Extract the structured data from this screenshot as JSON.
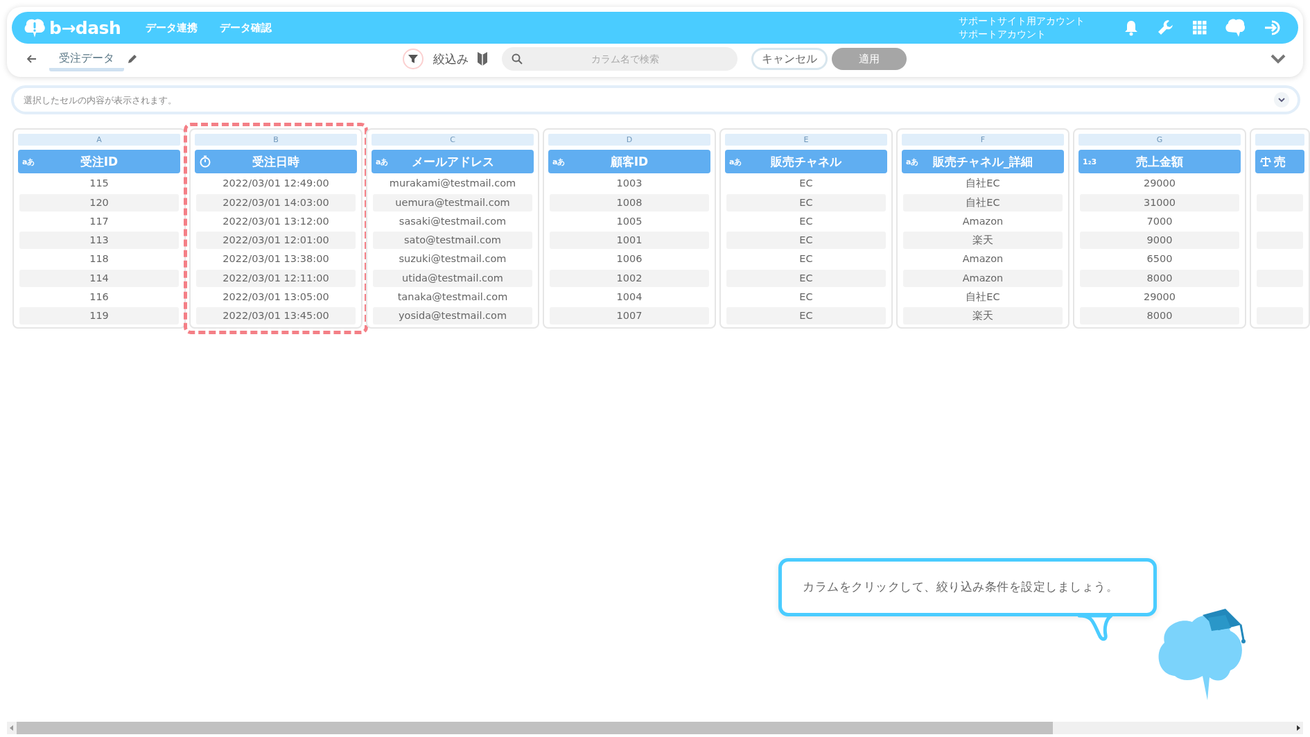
{
  "header": {
    "logo": "b→dash",
    "nav": [
      "データ連携",
      "データ確認"
    ],
    "account": [
      "サポートサイト用アカウント",
      "サポートアカウント"
    ]
  },
  "toolbar": {
    "title": "受注データ",
    "filter_label": "絞込み",
    "search": {
      "placeholder": "カラム名で検索"
    },
    "cancel": "キャンセル",
    "apply": {
      "label": "適用",
      "disabled": true
    }
  },
  "cell_bar": {
    "placeholder": "選択したセルの内容が表示されます。"
  },
  "columns": [
    {
      "letter": "A",
      "title": "受注ID",
      "kind": "text",
      "type_label": "aあ",
      "selected": false,
      "cells": [
        "115",
        "120",
        "117",
        "113",
        "118",
        "114",
        "116",
        "119"
      ]
    },
    {
      "letter": "B",
      "title": "受注日時",
      "kind": "datetime",
      "selected": true,
      "cells": [
        "2022/03/01 12:49:00",
        "2022/03/01 14:03:00",
        "2022/03/01 13:12:00",
        "2022/03/01 12:01:00",
        "2022/03/01 13:38:00",
        "2022/03/01 12:11:00",
        "2022/03/01 13:05:00",
        "2022/03/01 13:45:00"
      ]
    },
    {
      "letter": "C",
      "title": "メールアドレス",
      "kind": "text",
      "type_label": "aあ",
      "selected": false,
      "cells": [
        "murakami@testmail.com",
        "uemura@testmail.com",
        "sasaki@testmail.com",
        "sato@testmail.com",
        "suzuki@testmail.com",
        "utida@testmail.com",
        "tanaka@testmail.com",
        "yosida@testmail.com"
      ]
    },
    {
      "letter": "D",
      "title": "顧客ID",
      "kind": "text",
      "type_label": "aあ",
      "selected": false,
      "cells": [
        "1003",
        "1008",
        "1005",
        "1001",
        "1006",
        "1002",
        "1004",
        "1007"
      ]
    },
    {
      "letter": "E",
      "title": "販売チャネル",
      "kind": "text",
      "type_label": "aあ",
      "selected": false,
      "cells": [
        "EC",
        "EC",
        "EC",
        "EC",
        "EC",
        "EC",
        "EC",
        "EC"
      ]
    },
    {
      "letter": "F",
      "title": "販売チャネル_詳細",
      "kind": "text",
      "type_label": "aあ",
      "selected": false,
      "cells": [
        "自社EC",
        "自社EC",
        "Amazon",
        "楽天",
        "Amazon",
        "Amazon",
        "自社EC",
        "楽天"
      ]
    },
    {
      "letter": "G",
      "title": "売上金額",
      "kind": "number",
      "type_label": "1₂3",
      "selected": false,
      "cells": [
        "29000",
        "31000",
        "7000",
        "9000",
        "6500",
        "8000",
        "29000",
        "8000"
      ]
    },
    {
      "title": "売",
      "kind": "scale",
      "selected": false,
      "cells": [
        "",
        "",
        "",
        "",
        "",
        "",
        "",
        ""
      ]
    }
  ],
  "hint": {
    "text": "カラムをクリックして、絞り込み条件を設定しましょう。"
  }
}
